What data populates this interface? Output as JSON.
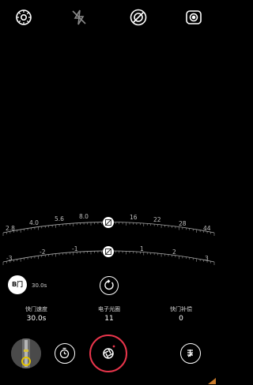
{
  "topbar": {
    "icons": [
      "settings-icon",
      "flash-off-icon",
      "no-hdr-icon",
      "camera-mode-icon"
    ]
  },
  "dials": {
    "top_labels": [
      "2.8",
      "4.0",
      "5.6",
      "8.0",
      "16",
      "22",
      "28",
      "44"
    ],
    "bottom_labels": [
      "-3",
      "-2",
      "-1",
      "1",
      "2",
      "3"
    ]
  },
  "controls": {
    "bulb_label": "B门",
    "bulb_value": "30.0s"
  },
  "params": {
    "shutter_speed": {
      "label": "快门速度",
      "value": "30.0s"
    },
    "aperture": {
      "label": "电子光圈",
      "value": "11"
    },
    "exposure_comp": {
      "label": "快门补偿",
      "value": "0"
    }
  },
  "colors": {
    "accent": "#e8354b",
    "background": "#000000",
    "bulb_bg": "#ffffff"
  }
}
